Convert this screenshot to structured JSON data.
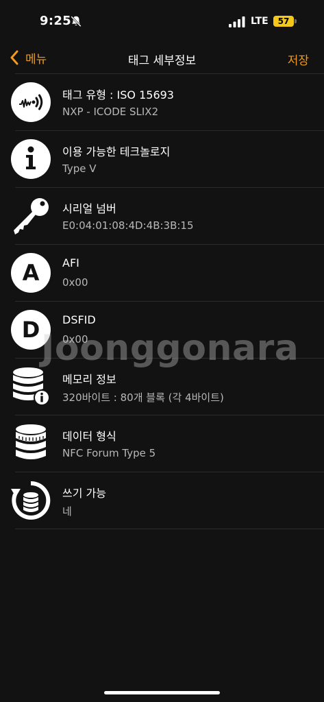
{
  "status_bar": {
    "time": "9:25",
    "network": "LTE",
    "battery": "57"
  },
  "nav": {
    "back_label": "메뉴",
    "title": "태그 세부정보",
    "save_label": "저장"
  },
  "rows": [
    {
      "icon": "nfc-wave-icon",
      "title": "태그 유형 : ISO 15693",
      "value": "NXP - ICODE SLIX2"
    },
    {
      "icon": "info-icon",
      "title": "이용 가능한 테크놀로지",
      "value": "Type V"
    },
    {
      "icon": "key-icon",
      "title": "시리얼 넘버",
      "value": "E0:04:01:08:4D:4B:3B:15"
    },
    {
      "icon": "letter-a-icon",
      "title": "AFI",
      "value": "0x00"
    },
    {
      "icon": "letter-d-icon",
      "title": "DSFID",
      "value": "0x00"
    },
    {
      "icon": "database-info-icon",
      "title": "메모리 정보",
      "value": "320바이트 : 80개 블록 (각 4바이트)"
    },
    {
      "icon": "database-icon",
      "title": "데이터 형식",
      "value": "NFC Forum Type 5"
    },
    {
      "icon": "database-rewrite-icon",
      "title": "쓰기 가능",
      "value": "네"
    }
  ],
  "watermark": "Joonggonara",
  "colors": {
    "accent": "#f29b1d",
    "background": "#121212",
    "battery": "#f4c81a"
  }
}
